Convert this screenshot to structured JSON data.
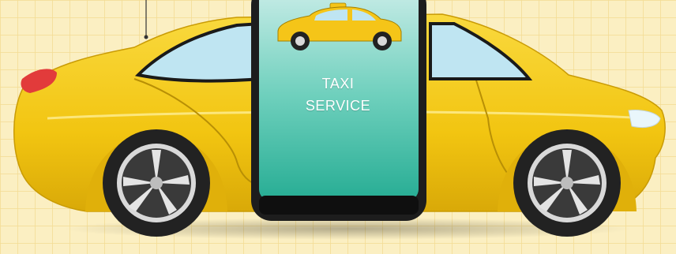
{
  "phone_screen": {
    "line1": "TAXI",
    "line2": "SERVICE"
  },
  "colors": {
    "background": "#fbefc2",
    "grid": "#f3dc92",
    "car_body": "#f5cc1a",
    "car_shadow": "#d6a800",
    "window": "#bfe5f2",
    "screen_top": "#b9e6e0",
    "screen_bottom": "#2bb39a",
    "phone_frame": "#1d1d1d",
    "tire": "#222222",
    "rim": "#d9d9d9",
    "tail_light": "#e23b3b",
    "head_light": "#e9f6fb"
  },
  "icons": {
    "phone": "smartphone-icon",
    "car": "taxi-car-icon",
    "app_car": "taxi-app-car-icon"
  }
}
